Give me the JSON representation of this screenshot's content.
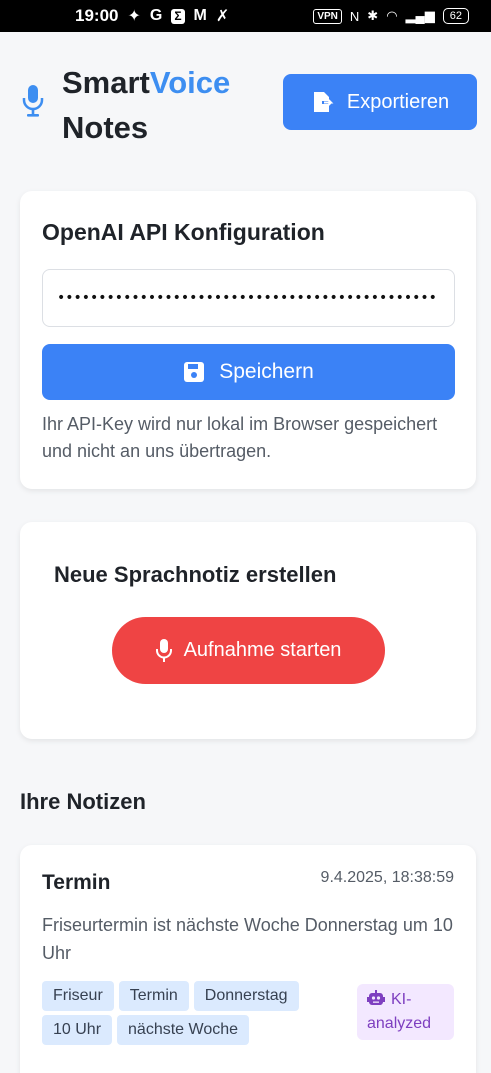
{
  "statusbar": {
    "time": "19:00",
    "icons": [
      "sparkle-icon",
      "google-icon",
      "sigma-icon",
      "gmail-icon",
      "missed-call-icon"
    ],
    "vpn": "VPN",
    "battery": "62"
  },
  "header": {
    "brand_part1": "Smart",
    "brand_part2": "Voice",
    "brand_part3": "Notes",
    "export_label": "Exportieren"
  },
  "api_config": {
    "title": "OpenAI API Konfiguration",
    "api_key_value": "••••••••••••••••••••••••••••••••••••••••••••••",
    "save_label": "Speichern",
    "note": "Ihr API-Key wird nur lokal im Browser gespeichert und nicht an uns übertragen."
  },
  "new_note": {
    "title": "Neue Sprachnotiz erstellen",
    "record_label": "Aufnahme starten"
  },
  "notes": {
    "section_title": "Ihre Notizen",
    "items": [
      {
        "title": "Termin",
        "date": "9.4.2025, 18:38:59",
        "text": "Friseurtermin ist nächste Woche Donnerstag um 10 Uhr",
        "tags": [
          "Friseur",
          "Termin",
          "Donnerstag",
          "10 Uhr",
          "nächste Woche"
        ],
        "badge": "KI-analyzed"
      }
    ]
  },
  "colors": {
    "primary": "#3b82f6",
    "accent_text": "#3d8ef1",
    "record": "#ef4444",
    "tag_bg": "#dbeafe",
    "badge_bg": "#f3e8ff",
    "badge_text": "#7e3fc0"
  }
}
